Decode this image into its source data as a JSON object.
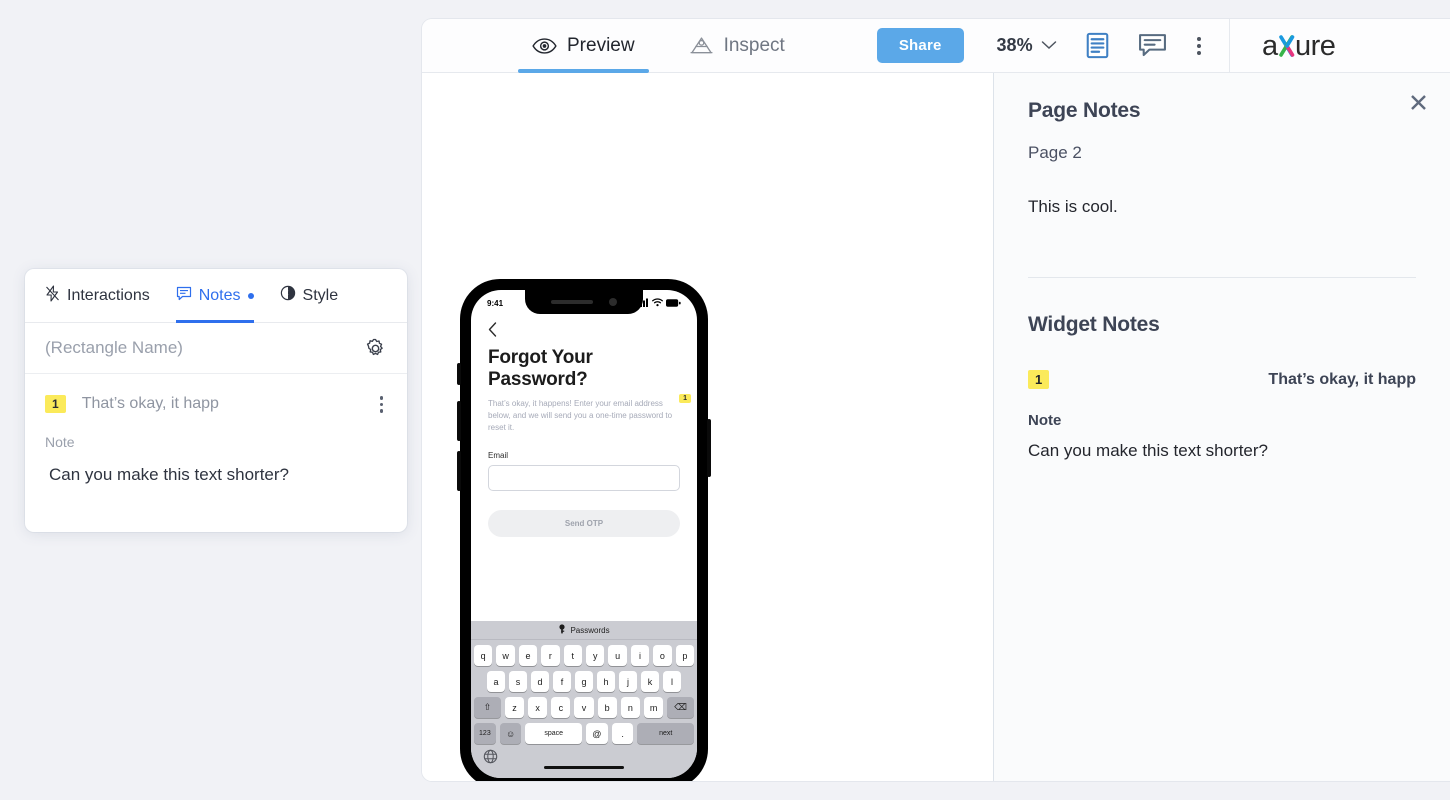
{
  "toolbar": {
    "tabs": [
      {
        "label": "Preview",
        "icon": "eye-icon",
        "active": true
      },
      {
        "label": "Inspect",
        "icon": "inspect-icon",
        "active": false
      }
    ],
    "share_label": "Share",
    "zoom_value": "38%",
    "icons": [
      "page-notes-icon",
      "comments-icon",
      "more-options-icon"
    ],
    "logo": {
      "pre": "a",
      "x": "x",
      "post": "ure"
    }
  },
  "notes_panel": {
    "page_notes_heading": "Page Notes",
    "page_name": "Page 2",
    "page_note_body": "This is cool.",
    "widget_notes_heading": "Widget Notes",
    "widget_badge": "1",
    "widget_label": "That’s okay, it happ",
    "note_field_label": "Note",
    "note_field_value": "Can you make this text shorter?",
    "close_label": "✖"
  },
  "inspector": {
    "tabs": [
      {
        "label": "Interactions",
        "icon": "lightning-icon",
        "active": false
      },
      {
        "label": "Notes",
        "icon": "speech-bubble-icon",
        "active": true
      },
      {
        "label": "Style",
        "icon": "contrast-icon",
        "active": false
      }
    ],
    "widget_name_placeholder": "(Rectangle Name)",
    "note_badge": "1",
    "note_title": "That’s okay, it happ",
    "note_label": "Note",
    "note_value": "Can you make this text shorter?"
  },
  "phone": {
    "status_time": "9:41",
    "back_icon": "chevron-left-icon",
    "title": "Forgot Your Password?",
    "subtitle": "That’s okay, it happens! Enter your email address below, and we will send you a one-time password to reset it.",
    "note_badge": "1",
    "email_label": "Email",
    "email_value": "",
    "submit_label": "Send OTP",
    "keyboard": {
      "suggestion": "Passwords",
      "row1": [
        "q",
        "w",
        "e",
        "r",
        "t",
        "y",
        "u",
        "i",
        "o",
        "p"
      ],
      "row2": [
        "a",
        "s",
        "d",
        "f",
        "g",
        "h",
        "j",
        "k",
        "l"
      ],
      "row3_shift": "⇧",
      "row3": [
        "z",
        "x",
        "c",
        "v",
        "b",
        "n",
        "m"
      ],
      "row3_backspace": "⌫",
      "row4_numbers": "123",
      "row4_emoji": "☺",
      "row4_space": "space",
      "row4_at": "@",
      "row4_period": ".",
      "row4_next": "next",
      "globe": "🌐"
    }
  },
  "colors": {
    "accent_blue": "#5ba8e8",
    "tab_blue": "#2f6fed",
    "badge_yellow": "#fbea5a",
    "page_bg": "#f1f2f6"
  }
}
